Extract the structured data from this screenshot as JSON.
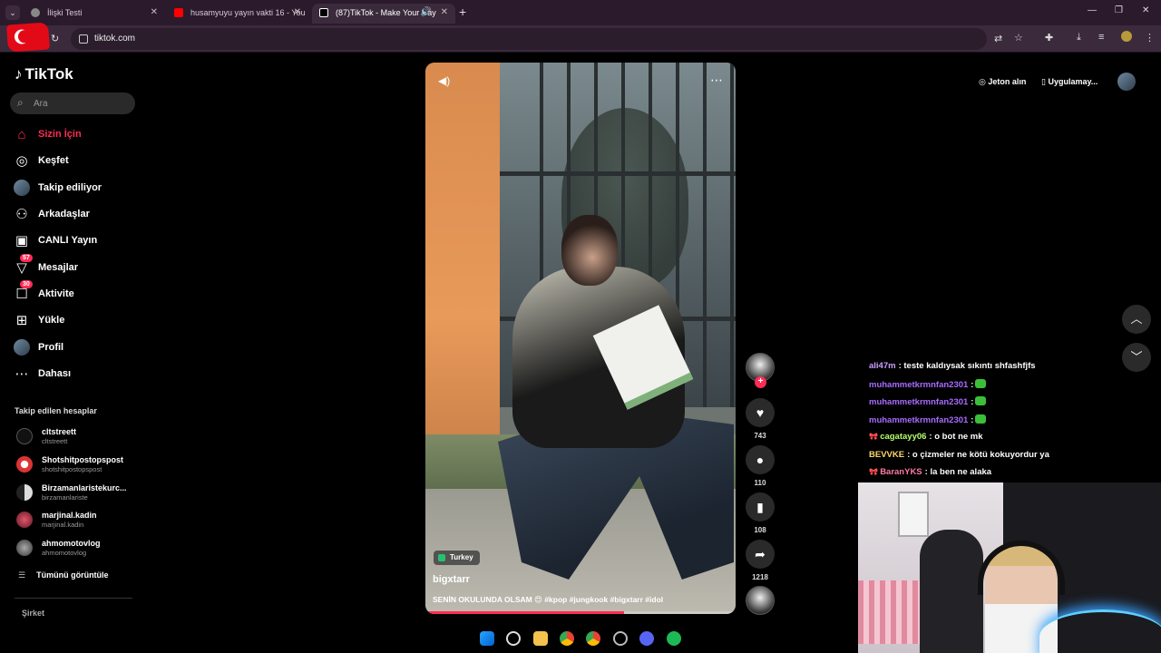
{
  "browser": {
    "tabs": [
      {
        "title": "İlişki Testi",
        "active": false
      },
      {
        "title": "husamyuyu yayın vakti 16 - You",
        "active": false
      },
      {
        "title": "(87)TikTok - Make Your Day",
        "active": true
      }
    ],
    "url": "tiktok.com"
  },
  "tiktok": {
    "logo": "TikTok",
    "search_placeholder": "Ara",
    "nav": [
      {
        "label": "Sizin İçin",
        "icon": "home-icon",
        "active": true
      },
      {
        "label": "Keşfet",
        "icon": "compass-icon"
      },
      {
        "label": "Takip ediliyor",
        "icon": "avatar"
      },
      {
        "label": "Arkadaşlar",
        "icon": "friends-icon"
      },
      {
        "label": "CANLI Yayın",
        "icon": "live-icon"
      },
      {
        "label": "Mesajlar",
        "icon": "messages-icon",
        "badge": "57"
      },
      {
        "label": "Aktivite",
        "icon": "activity-icon",
        "badge": "30"
      },
      {
        "label": "Yükle",
        "icon": "upload-icon"
      },
      {
        "label": "Profil",
        "icon": "avatar"
      },
      {
        "label": "Dahası",
        "icon": "more-icon"
      }
    ],
    "following_title": "Takip edilen hesaplar",
    "following": [
      {
        "name": "cltstreett",
        "handle": "cltstreett"
      },
      {
        "name": "Shotshitpostopspost",
        "handle": "shotshitpostopspost"
      },
      {
        "name": "Birzamanlaristekurc...",
        "handle": "birzamanlariste"
      },
      {
        "name": "marjinal.kadin",
        "handle": "marjinal.kadin"
      },
      {
        "name": "ahmomotovlog",
        "handle": "ahmomotovlog"
      }
    ],
    "see_all": "Tümünü görüntüle",
    "company": "Şirket",
    "top_right": {
      "coins": "Jeton alın",
      "app": "Uygulamay..."
    }
  },
  "video": {
    "location": "Turkey",
    "author": "bigxtarr",
    "caption": "SENİN OKULUNDA OLSAM 😍 #kpop #jungkook #bigxtarr #idol",
    "progress": 0.64,
    "likes": "743",
    "comments": "110",
    "saves": "108",
    "shares": "1218"
  },
  "chat": [
    {
      "user": "ali47m",
      "color": "#c9a0ff",
      "text": ": teste kaldıysak sıkıntı shfashfjfs",
      "badge": false,
      "emote": false
    },
    {
      "user": "muhammetkrmnfan2301",
      "color": "#a86bff",
      "text": ":",
      "badge": false,
      "emote": true
    },
    {
      "user": "muhammetkrmnfan2301",
      "color": "#a86bff",
      "text": ":",
      "badge": false,
      "emote": true
    },
    {
      "user": "muhammetkrmnfan2301",
      "color": "#a86bff",
      "text": ":",
      "badge": false,
      "emote": true
    },
    {
      "user": "cagatayy06",
      "color": "#b6ff6b",
      "text": ": o bot ne mk",
      "badge": true,
      "emote": false
    },
    {
      "user": "BEVVKE",
      "color": "#ffd76b",
      "text": ": o çizmeler ne kötü kokuyordur ya",
      "badge": false,
      "emote": false
    },
    {
      "user": "BaranYKS",
      "color": "#ff7aa8",
      "text": ": la ben ne alaka",
      "badge": true,
      "emote": false
    }
  ],
  "colors": {
    "accent": "#fe2c55",
    "chrome": "#3a2a3b"
  }
}
